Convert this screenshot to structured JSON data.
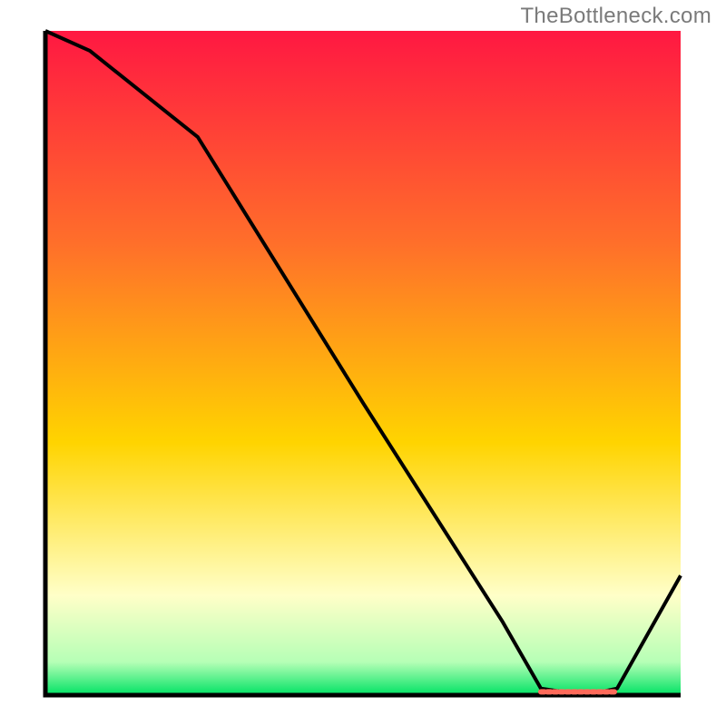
{
  "attribution": "TheBottleneck.com",
  "colors": {
    "gradient_top": "#ff1842",
    "gradient_mid1": "#ff6f2a",
    "gradient_mid2": "#ffd400",
    "gradient_pale": "#ffffc8",
    "gradient_band": "#b6ffb6",
    "gradient_bottom": "#00e264",
    "curve": "#000000",
    "marker": "#ff6a5a",
    "axes": "#000000"
  },
  "chart_data": {
    "type": "line",
    "title": "",
    "xlabel": "",
    "ylabel": "",
    "xlim": [
      0,
      100
    ],
    "ylim": [
      0,
      100
    ],
    "series": [
      {
        "name": "curve",
        "x": [
          0,
          7,
          24,
          50,
          72,
          78,
          85,
          90,
          100
        ],
        "values": [
          100,
          97,
          84,
          44,
          11,
          1,
          0,
          1,
          18
        ]
      }
    ],
    "marker_segment": {
      "x0": 78,
      "x1": 90,
      "y": 0.5
    }
  }
}
